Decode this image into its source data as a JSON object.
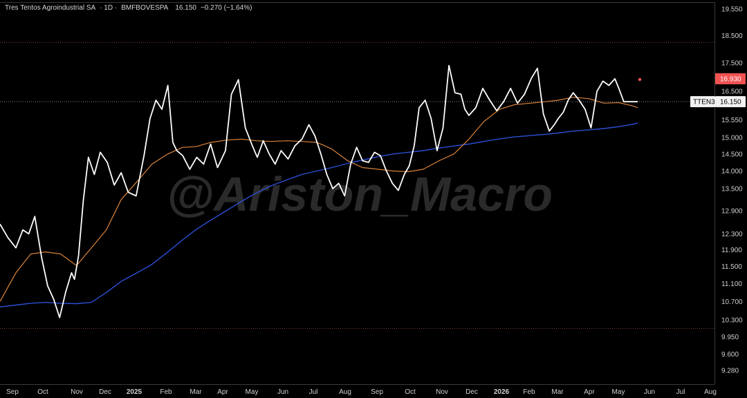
{
  "header": {
    "symbol_name": "Tres Tentos Agroindustrial SA",
    "interval": "· 1D ·",
    "exchange": "BMFBOVESPA",
    "price": "16.150",
    "change": "−0.270 (−1.64%)"
  },
  "watermark": "@Ariston_Macro",
  "price_scale": {
    "ticks": [
      "19.550",
      "18.500",
      "17.500",
      "16.500",
      "15.550",
      "15.000",
      "14.500",
      "14.000",
      "13.500",
      "12.900",
      "12.300",
      "11.900",
      "11.500",
      "11.100",
      "10.700",
      "10.300",
      "9.950",
      "9.600",
      "9.280"
    ],
    "last_label": "16.150",
    "ticker_label": "TTEN3",
    "high_label": "16.930"
  },
  "colors": {
    "price_line": "#ffffff",
    "ma_fast": "#d9833a",
    "ma_slow": "#2c4fd6",
    "label_red": "#f05252",
    "dotted_line": "#7a4a3a",
    "grid_text": "#cfcfcf"
  },
  "chart_data": {
    "type": "line",
    "title": "Tres Tentos Agroindustrial SA · 1D · BMFBOVESPA",
    "x_tick_labels": [
      "Sep",
      "Oct",
      "Nov",
      "Dec",
      "2025",
      "Feb",
      "Mar",
      "Apr",
      "May",
      "Jun",
      "Jul",
      "Aug",
      "Sep",
      "Oct",
      "Nov",
      "Dec",
      "2026",
      "Feb",
      "Mar",
      "Apr",
      "May",
      "Jun",
      "Jul",
      "Aug"
    ],
    "ylim": [
      9.1,
      20.0
    ],
    "y_scale": "log",
    "horizontal_levels": [
      18.25,
      10.12
    ],
    "series": [
      {
        "role": "price",
        "x": [
          "2024-08-20",
          "2024-08-28",
          "2024-09-05",
          "2024-09-12",
          "2024-09-18",
          "2024-09-24",
          "2024-10-01",
          "2024-10-07",
          "2024-10-13",
          "2024-10-19",
          "2024-10-25",
          "2024-10-31",
          "2024-11-03",
          "2024-11-07",
          "2024-11-12",
          "2024-11-17",
          "2024-11-23",
          "2024-11-29",
          "2024-12-06",
          "2024-12-13",
          "2024-12-20",
          "2024-12-27",
          "2025-01-04",
          "2025-01-12",
          "2025-01-18",
          "2025-01-24",
          "2025-01-30",
          "2025-02-05",
          "2025-02-10",
          "2025-02-14",
          "2025-02-20",
          "2025-02-27",
          "2025-03-06",
          "2025-03-13",
          "2025-03-20",
          "2025-03-27",
          "2025-04-04",
          "2025-04-10",
          "2025-04-17",
          "2025-04-24",
          "2025-05-01",
          "2025-05-06",
          "2025-05-12",
          "2025-05-18",
          "2025-05-24",
          "2025-05-30",
          "2025-06-06",
          "2025-06-13",
          "2025-06-20",
          "2025-06-27",
          "2025-07-03",
          "2025-07-09",
          "2025-07-15",
          "2025-07-21",
          "2025-07-27",
          "2025-08-02",
          "2025-08-08",
          "2025-08-14",
          "2025-08-20",
          "2025-08-26",
          "2025-09-01",
          "2025-09-07",
          "2025-09-13",
          "2025-09-19",
          "2025-09-25",
          "2025-10-01",
          "2025-10-06",
          "2025-10-11",
          "2025-10-16",
          "2025-10-22",
          "2025-10-28",
          "2025-11-03",
          "2025-11-09",
          "2025-11-15",
          "2025-11-21",
          "2025-11-27",
          "2025-12-01",
          "2025-12-05",
          "2025-12-12",
          "2025-12-19",
          "2025-12-26",
          "2026-01-02",
          "2026-01-09",
          "2026-01-16",
          "2026-01-23",
          "2026-01-30",
          "2026-02-06",
          "2026-02-12",
          "2026-02-18",
          "2026-02-24",
          "2026-03-01",
          "2026-03-05",
          "2026-03-10",
          "2026-03-15",
          "2026-03-20",
          "2026-03-26",
          "2026-04-01",
          "2026-04-07",
          "2026-04-13",
          "2026-04-19",
          "2026-04-25",
          "2026-05-01",
          "2026-05-05",
          "2026-05-10",
          "2026-05-15",
          "2026-05-20",
          "2026-05-24"
        ],
        "y": [
          12.55,
          12.2,
          11.95,
          12.4,
          12.3,
          12.75,
          11.7,
          11.05,
          10.75,
          10.35,
          10.9,
          11.35,
          11.2,
          11.75,
          13.2,
          14.4,
          13.9,
          14.55,
          14.25,
          13.6,
          13.95,
          13.4,
          13.3,
          14.45,
          15.6,
          16.2,
          15.9,
          16.7,
          14.85,
          14.6,
          14.45,
          14.05,
          14.4,
          14.2,
          14.8,
          14.1,
          14.6,
          16.4,
          16.9,
          15.3,
          14.75,
          14.4,
          14.9,
          14.5,
          14.2,
          14.6,
          14.35,
          14.75,
          14.95,
          15.4,
          15.05,
          14.5,
          13.9,
          13.5,
          13.65,
          13.3,
          14.2,
          14.7,
          14.3,
          14.25,
          14.55,
          14.45,
          14.0,
          13.65,
          13.45,
          13.9,
          14.15,
          14.75,
          15.95,
          16.2,
          15.6,
          14.6,
          15.3,
          17.4,
          16.45,
          16.4,
          15.9,
          15.7,
          15.95,
          16.6,
          16.2,
          15.85,
          16.15,
          16.6,
          16.1,
          16.4,
          16.95,
          17.3,
          15.75,
          15.2,
          15.4,
          15.6,
          15.8,
          16.2,
          16.45,
          16.2,
          15.9,
          15.3,
          16.5,
          16.85,
          16.7,
          16.93,
          16.6,
          16.15,
          16.15,
          16.15,
          16.15
        ],
        "name": ""
      },
      {
        "role": "moving_average_fast",
        "x": [
          "2024-08-20",
          "2024-09-05",
          "2024-09-20",
          "2024-10-05",
          "2024-10-20",
          "2024-11-05",
          "2024-11-20",
          "2024-12-05",
          "2024-12-20",
          "2025-01-05",
          "2025-01-20",
          "2025-02-05",
          "2025-02-20",
          "2025-03-05",
          "2025-03-20",
          "2025-04-05",
          "2025-04-20",
          "2025-05-05",
          "2025-05-20",
          "2025-06-05",
          "2025-06-20",
          "2025-07-05",
          "2025-07-20",
          "2025-08-05",
          "2025-08-20",
          "2025-09-05",
          "2025-09-20",
          "2025-10-05",
          "2025-10-20",
          "2025-11-05",
          "2025-11-20",
          "2025-12-05",
          "2025-12-20",
          "2026-01-05",
          "2026-01-20",
          "2026-02-05",
          "2026-02-20",
          "2026-03-05",
          "2026-03-20",
          "2026-04-05",
          "2026-04-20",
          "2026-05-05",
          "2026-05-20",
          "2026-05-24"
        ],
        "y": [
          10.7,
          11.35,
          11.8,
          11.85,
          11.8,
          11.52,
          11.95,
          12.4,
          13.2,
          13.7,
          14.2,
          14.5,
          14.7,
          14.72,
          14.85,
          14.92,
          14.95,
          14.9,
          14.88,
          14.9,
          14.88,
          14.85,
          14.65,
          14.3,
          14.1,
          14.05,
          14.0,
          13.98,
          14.05,
          14.3,
          14.5,
          14.95,
          15.5,
          15.9,
          16.05,
          16.1,
          16.15,
          16.2,
          16.3,
          16.25,
          16.1,
          16.12,
          16.0,
          15.95
        ],
        "name": ""
      },
      {
        "role": "moving_average_slow",
        "x": [
          "2024-08-20",
          "2024-09-05",
          "2024-09-20",
          "2024-10-05",
          "2024-10-20",
          "2024-11-05",
          "2024-11-20",
          "2024-12-05",
          "2024-12-20",
          "2025-01-05",
          "2025-01-20",
          "2025-02-05",
          "2025-02-20",
          "2025-03-05",
          "2025-03-20",
          "2025-04-05",
          "2025-04-20",
          "2025-05-05",
          "2025-05-20",
          "2025-06-05",
          "2025-06-20",
          "2025-07-05",
          "2025-07-20",
          "2025-08-05",
          "2025-08-20",
          "2025-09-05",
          "2025-09-20",
          "2025-10-05",
          "2025-10-20",
          "2025-11-05",
          "2025-11-20",
          "2025-12-05",
          "2025-12-20",
          "2026-01-05",
          "2026-01-20",
          "2026-02-05",
          "2026-02-20",
          "2026-03-05",
          "2026-03-20",
          "2026-04-05",
          "2026-04-20",
          "2026-05-05",
          "2026-05-20",
          "2026-05-24"
        ],
        "y": [
          10.58,
          10.62,
          10.66,
          10.68,
          10.66,
          10.65,
          10.68,
          10.9,
          11.15,
          11.35,
          11.55,
          11.85,
          12.15,
          12.4,
          12.65,
          12.9,
          13.15,
          13.38,
          13.58,
          13.75,
          13.9,
          14.0,
          14.1,
          14.22,
          14.32,
          14.42,
          14.5,
          14.55,
          14.6,
          14.68,
          14.74,
          14.8,
          14.88,
          14.96,
          15.02,
          15.06,
          15.1,
          15.14,
          15.2,
          15.24,
          15.28,
          15.34,
          15.42,
          15.46
        ],
        "name": ""
      }
    ]
  }
}
